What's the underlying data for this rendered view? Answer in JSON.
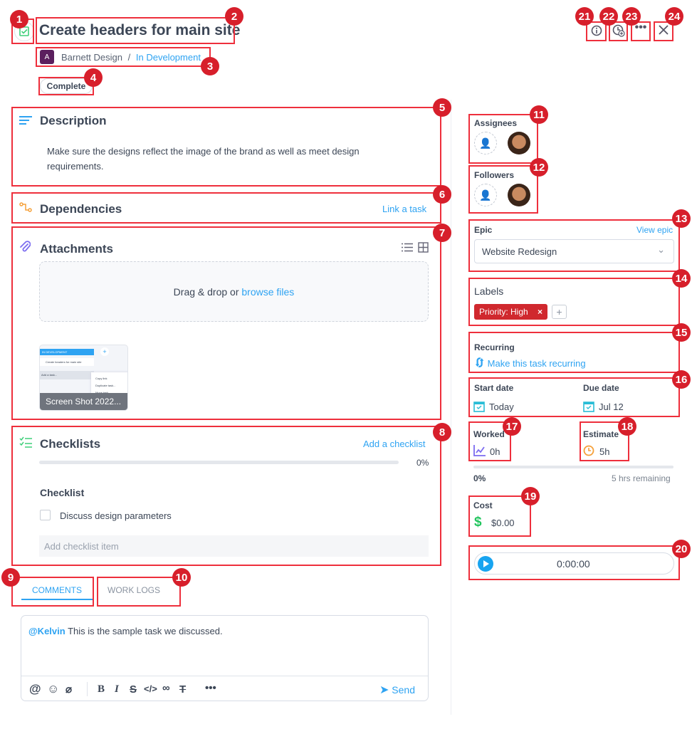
{
  "header": {
    "title": "Create headers for main site",
    "workspace_initial": "A",
    "workspace": "Barnett Design",
    "separator": "/",
    "status": "In Development",
    "complete_button": "Complete"
  },
  "toolbar": {
    "icons": [
      "info-icon",
      "clock-add-icon",
      "more-icon",
      "close-icon"
    ]
  },
  "description": {
    "title": "Description",
    "text_line1": "Make sure the designs reflect the image of the brand as well as meet design",
    "text_line2": "requirements."
  },
  "dependencies": {
    "title": "Dependencies",
    "link": "Link a task"
  },
  "attachments": {
    "title": "Attachments",
    "drop_text": "Drag & drop or ",
    "browse": "browse files",
    "thumb_caption": "Screen Shot 2022...",
    "thumb_header": "IN DEVELOPMENT",
    "thumb_task": "Create headers for main site",
    "thumb_add": "Add a task...",
    "thumb_menu": [
      "Copy link",
      "Duplicate task...",
      "Move task...",
      "Dependencies..."
    ]
  },
  "checklists": {
    "title": "Checklists",
    "add": "Add a checklist",
    "progress_percent": 0,
    "progress_label": "0%",
    "checklist_title": "Checklist",
    "items": [
      {
        "text": "Discuss design parameters",
        "checked": false
      }
    ],
    "add_item_placeholder": "Add checklist item"
  },
  "tabs": [
    {
      "label": "COMMENTS",
      "active": true
    },
    {
      "label": "WORK LOGS",
      "active": false
    }
  ],
  "comment": {
    "mention": "@Kelvin",
    "text": " This is the sample task we discussed.",
    "send": "Send"
  },
  "sidebar": {
    "assignees": "Assignees",
    "followers": "Followers",
    "epic": {
      "label": "Epic",
      "view": "View epic",
      "value": "Website Redesign"
    },
    "labels": {
      "label": "Labels",
      "tag": "Priority: High",
      "tag_color": "#d0282e"
    },
    "recurring": {
      "label": "Recurring",
      "link": "Make this task recurring"
    },
    "start": {
      "label": "Start date",
      "value": "Today"
    },
    "due": {
      "label": "Due date",
      "value": "Jul 12"
    },
    "worked": {
      "label": "Worked",
      "value": "0h"
    },
    "estimate": {
      "label": "Estimate",
      "value": "5h"
    },
    "time_progress_percent": 0,
    "time_progress_label": "0%",
    "remaining": "5 hrs remaining",
    "cost": {
      "label": "Cost",
      "value": "$0.00"
    },
    "timer": "0:00:00"
  },
  "annotations": [
    "1",
    "2",
    "3",
    "4",
    "5",
    "6",
    "7",
    "8",
    "9",
    "10",
    "11",
    "12",
    "13",
    "14",
    "15",
    "16",
    "17",
    "18",
    "19",
    "20",
    "21",
    "22",
    "23",
    "24"
  ],
  "colors": {
    "accent": "#2ea3f2",
    "annotation": "#ee2f3c",
    "annotation_badge": "#d71f2b"
  }
}
